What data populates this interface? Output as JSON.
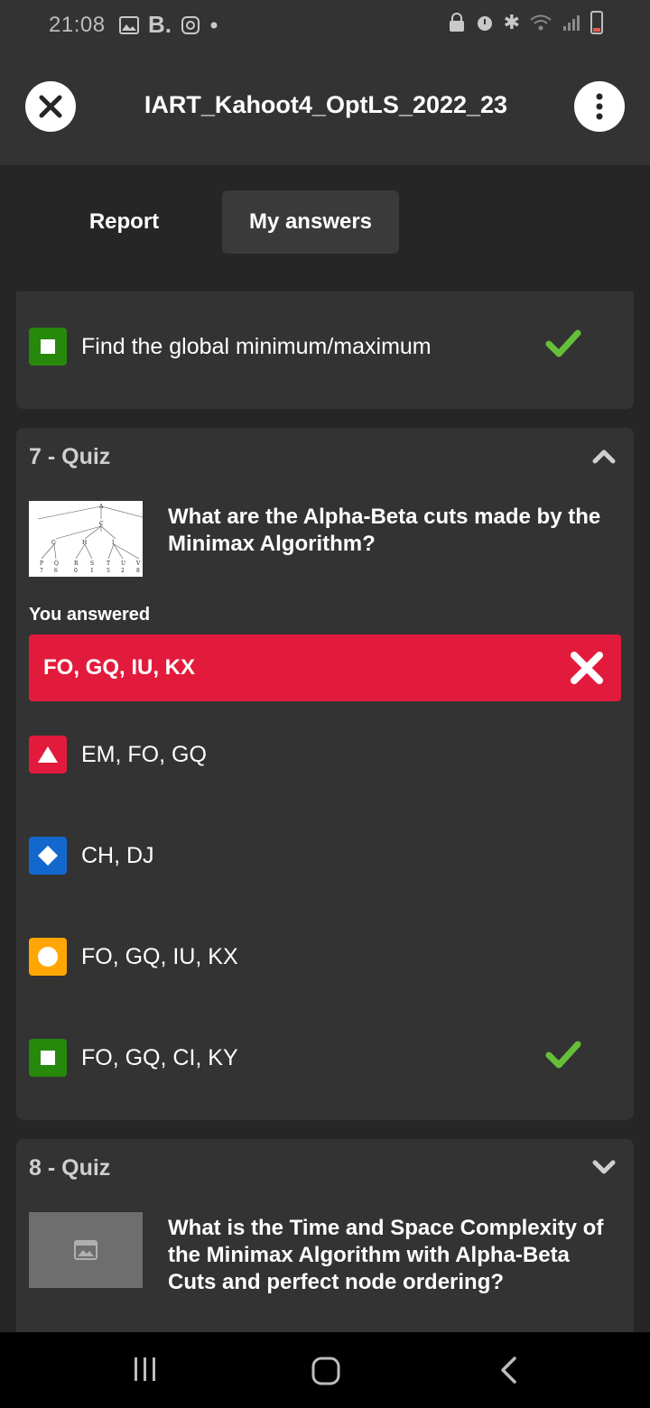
{
  "status_bar": {
    "time": "21:08",
    "left_icons": [
      "gallery-icon",
      "b-app-icon",
      "instagram-icon",
      "dot-icon"
    ],
    "right_icons": [
      "lock-icon",
      "alarm-icon",
      "bluetooth-icon",
      "wifi-icon",
      "signal-icon",
      "battery-icon"
    ]
  },
  "app_bar": {
    "title": "IART_Kahoot4_OptLS_2022_23"
  },
  "tabs": [
    {
      "label": "Report",
      "selected": false
    },
    {
      "label": "My answers",
      "selected": true
    }
  ],
  "prev_card": {
    "option": {
      "shape": "square",
      "color": "#26890c",
      "text": "Find the global minimum/maximum",
      "correct": true
    }
  },
  "question7": {
    "header": "7 - Quiz",
    "question": "What are the Alpha-Beta cuts made by the Minimax Algorithm?",
    "thumbnail": {
      "root": "A",
      "mid": "C",
      "level2": [
        "G",
        "H",
        "I"
      ],
      "leaf_letters": [
        "P",
        "Q",
        "R",
        "S",
        "T",
        "U",
        "V"
      ],
      "leaf_values": [
        "7",
        "6",
        "0",
        "1",
        "5",
        "2",
        "8"
      ]
    },
    "you_answered_label": "You answered",
    "your_answer": "FO, GQ, IU, KX",
    "options": [
      {
        "shape": "triangle",
        "color": "#e21b3c",
        "text": "EM, FO, GQ",
        "correct": false
      },
      {
        "shape": "diamond",
        "color": "#1368ce",
        "text": "CH, DJ",
        "correct": false
      },
      {
        "shape": "circle",
        "color": "#ffa602",
        "text": "FO, GQ, IU, KX",
        "correct": false
      },
      {
        "shape": "square",
        "color": "#26890c",
        "text": "FO, GQ, CI, KY",
        "correct": true
      }
    ]
  },
  "question8": {
    "header": "8 - Quiz",
    "question": "What is the Time and Space Complexity of the Minimax Algorithm with Alpha-Beta Cuts and perfect node ordering?"
  },
  "nav_bar": {
    "items": [
      "recent-apps-icon",
      "home-icon",
      "back-icon"
    ]
  }
}
